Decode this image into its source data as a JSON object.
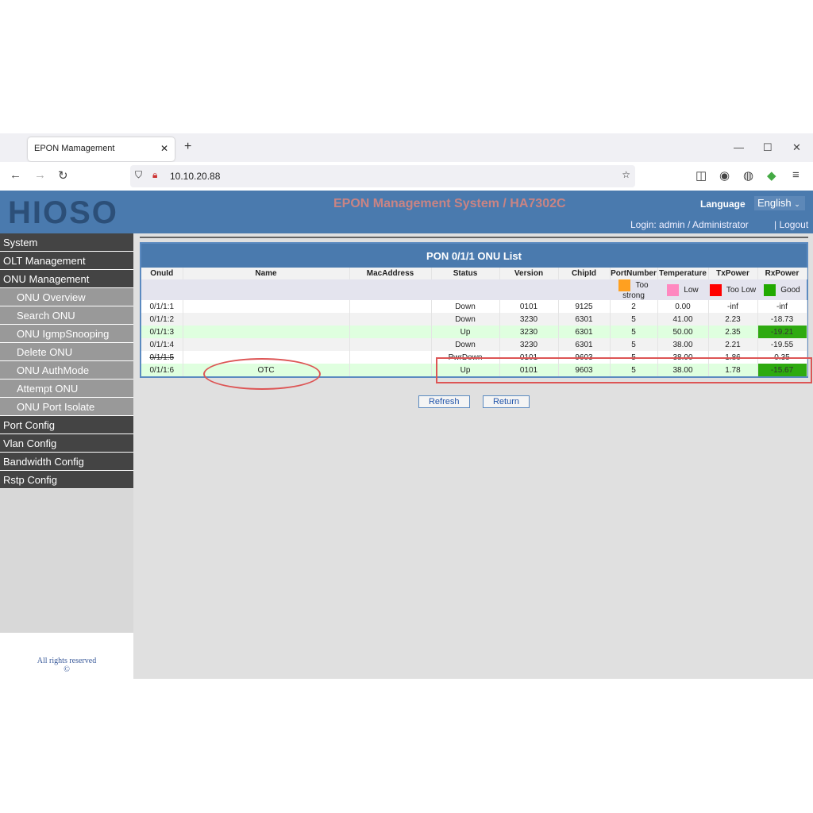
{
  "browser": {
    "tab_title": "EPON Mamagement",
    "url": "10.10.20.88"
  },
  "header": {
    "logo": "HIOSO",
    "title": "EPON Management System / HA7302C",
    "language_label": "Language",
    "language_value": "English",
    "login": "Login: admin / Administrator",
    "logout": "| Logout"
  },
  "sidebar": [
    {
      "label": "System",
      "level": "top"
    },
    {
      "label": "OLT Management",
      "level": "top"
    },
    {
      "label": "ONU Management",
      "level": "top"
    },
    {
      "label": "ONU Overview",
      "level": "sub"
    },
    {
      "label": "Search ONU",
      "level": "sub"
    },
    {
      "label": "ONU IgmpSnooping",
      "level": "sub"
    },
    {
      "label": "Delete ONU",
      "level": "sub"
    },
    {
      "label": "ONU AuthMode",
      "level": "sub"
    },
    {
      "label": "Attempt ONU",
      "level": "sub"
    },
    {
      "label": "ONU Port Isolate",
      "level": "sub"
    },
    {
      "label": "Port Config",
      "level": "top"
    },
    {
      "label": "Vlan Config",
      "level": "top"
    },
    {
      "label": "Bandwidth Config",
      "level": "top"
    },
    {
      "label": "Rstp Config",
      "level": "top"
    }
  ],
  "footer": {
    "rights": "All rights reserved",
    "copyright": "©"
  },
  "table": {
    "title": "PON 0/1/1 ONU List",
    "columns": [
      "OnuId",
      "Name",
      "MacAddress",
      "Status",
      "Version",
      "ChipId",
      "PortNumber",
      "Temperature",
      "TxPower",
      "RxPower"
    ],
    "legend": [
      {
        "label": "Too strong",
        "color": "#ffa020"
      },
      {
        "label": "Low",
        "color": "#ff88c0"
      },
      {
        "label": "Too Low",
        "color": "#ff0000"
      },
      {
        "label": "Good",
        "color": "#22aa00"
      }
    ],
    "rows": [
      [
        "0/1/1:1",
        "",
        "",
        "Down",
        "0101",
        "9125",
        "2",
        "0.00",
        "-inf",
        "-inf"
      ],
      [
        "0/1/1:2",
        "",
        "",
        "Down",
        "3230",
        "6301",
        "5",
        "41.00",
        "2.23",
        "-18.73"
      ],
      [
        "0/1/1:3",
        "",
        "",
        "Up",
        "3230",
        "6301",
        "5",
        "50.00",
        "2.35",
        "-19.21"
      ],
      [
        "0/1/1:4",
        "",
        "",
        "Down",
        "3230",
        "6301",
        "5",
        "38.00",
        "2.21",
        "-19.55"
      ],
      [
        "0/1/1:5",
        "",
        "",
        "PwrDown",
        "0101",
        "9603",
        "5",
        "38.00",
        "1.86",
        "0.35"
      ],
      [
        "0/1/1:6",
        "OTC",
        "",
        "Up",
        "0101",
        "9603",
        "5",
        "38.00",
        "1.78",
        "-15.67"
      ]
    ],
    "row_styles": [
      "w",
      "a",
      "g",
      "a",
      "w",
      "g"
    ],
    "good_rx": [
      2,
      5
    ]
  },
  "buttons": {
    "refresh": "Refresh",
    "return": "Return"
  }
}
